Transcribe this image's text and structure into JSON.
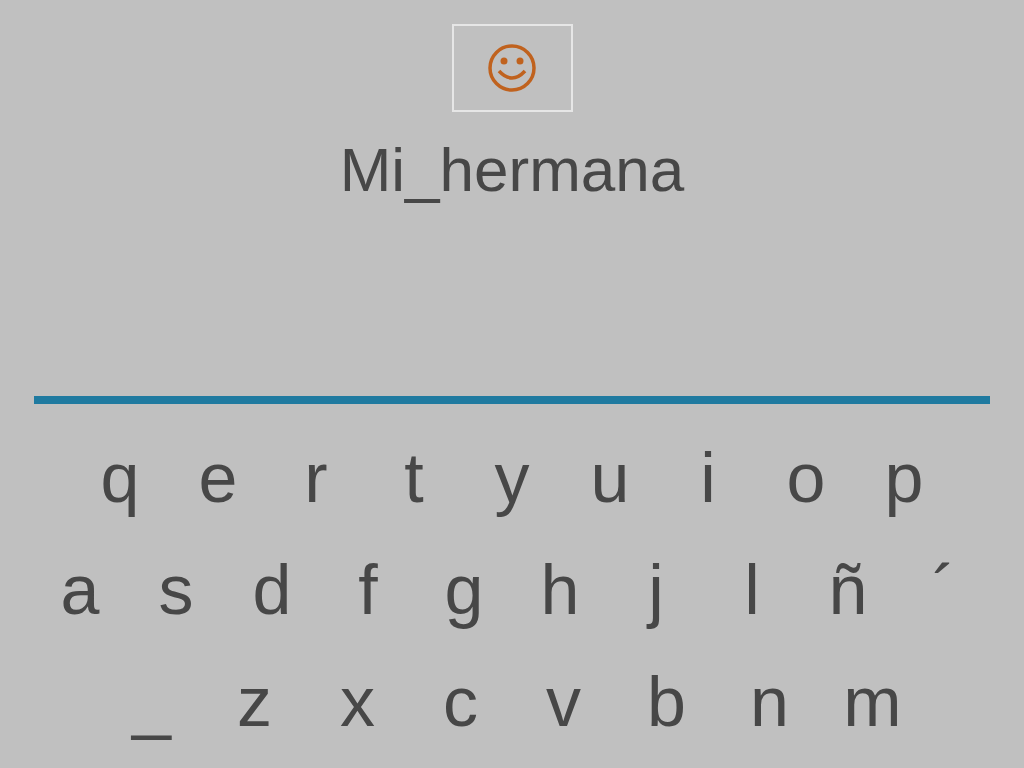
{
  "word": "Mi_hermana",
  "keyboard": {
    "rows": [
      [
        "q",
        "e",
        "r",
        "t",
        "y",
        "u",
        "i",
        "o",
        "p"
      ],
      [
        "a",
        "s",
        "d",
        "f",
        "g",
        "h",
        "j",
        "l",
        "ñ",
        "´"
      ],
      [
        "_",
        "z",
        "x",
        "c",
        "v",
        "b",
        "n",
        "m"
      ]
    ]
  }
}
